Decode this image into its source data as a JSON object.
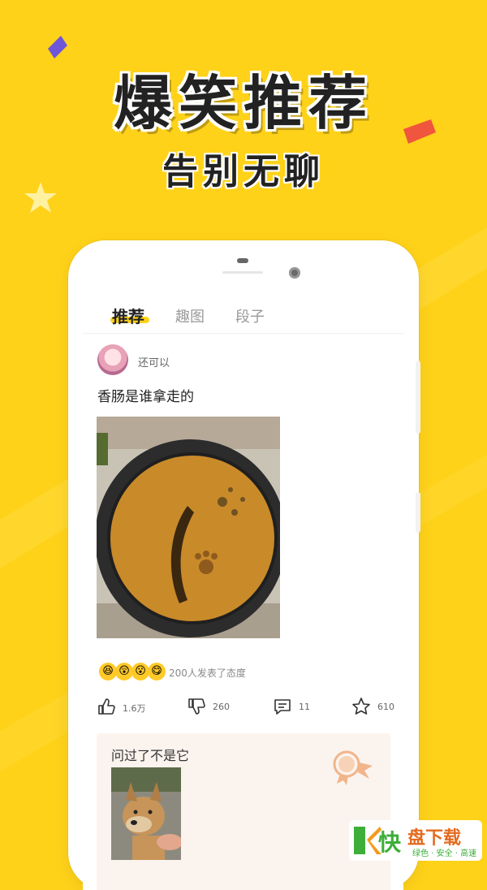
{
  "promo": {
    "headline": "爆笑推荐",
    "subhead": "告别无聊"
  },
  "tabs": [
    {
      "label": "推荐",
      "active": true
    },
    {
      "label": "趣图",
      "active": false
    },
    {
      "label": "段子",
      "active": false
    }
  ],
  "post": {
    "username": "还可以",
    "title": "香肠是谁拿走的",
    "reactions": {
      "emojis": [
        "😆",
        "😲",
        "😮",
        "😋"
      ],
      "text": "200人发表了态度"
    },
    "actions": {
      "like_count": "1.6万",
      "dislike_count": "260",
      "comment_count": "11",
      "favorite_count": "610"
    },
    "top_comment": {
      "text": "问过了不是它"
    }
  },
  "watermark": {
    "char": "快",
    "title": "盘下载",
    "subtitle": "绿色 · 安全 · 高速"
  },
  "colors": {
    "background": "#FFD21A",
    "tab_underline": "#FFD21A",
    "comment_card": "#FBF3EE"
  }
}
